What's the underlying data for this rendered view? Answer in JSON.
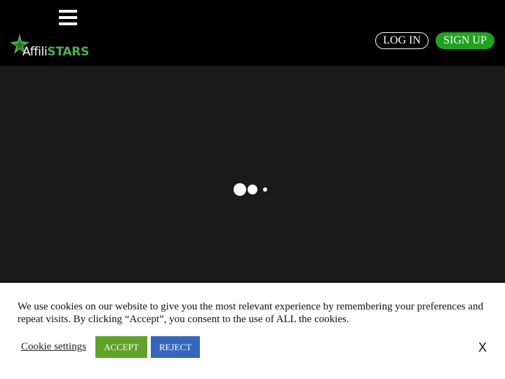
{
  "header": {
    "menu_icon": "hamburger-menu-icon",
    "logo": {
      "icon": "green-star-logo-icon",
      "text_part1": "Affili",
      "text_part2": "STARS"
    },
    "login_label": "LOG IN",
    "signup_label": "SIGN UP"
  },
  "main": {
    "loader_icon": "loading-dots-icon"
  },
  "cookie_banner": {
    "message": "We use cookies on our website to give you the most relevant experience by remembering your preferences and repeat visits. By clicking “Accept”, you consent to the use of ALL the cookies.",
    "settings_label": "Cookie settings",
    "accept_label": "ACCEPT",
    "reject_label": "REJECT",
    "close_label": "X"
  },
  "colors": {
    "header_bg": "#000000",
    "page_bg": "#1a1a1a",
    "signup_green": "#1fa31f",
    "accept_green": "#61a229",
    "reject_blue": "#3566bb",
    "logo_green": "#4caf50"
  }
}
